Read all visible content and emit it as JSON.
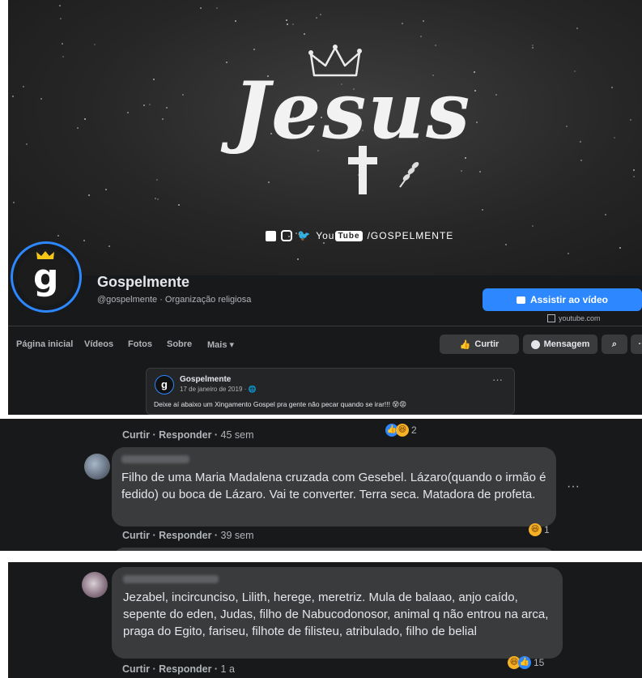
{
  "cover": {
    "script_word": "Jesus",
    "social_handle": "/GOSPELMENTE",
    "social_icons": [
      "facebook-icon",
      "instagram-icon",
      "twitter-icon",
      "youtube-icon"
    ],
    "youtube_word": "You",
    "youtube_box": "Tube"
  },
  "profile": {
    "avatar_letter": "g",
    "name": "Gospelmente",
    "subtitle": "@gospelmente · Organização religiosa",
    "cta_label": "Assistir ao vídeo",
    "cta_link": "youtube.com"
  },
  "nav": {
    "items": [
      "Página inicial",
      "Vídeos",
      "Fotos",
      "Sobre",
      "Mais ▾"
    ],
    "like_label": "Curtir",
    "message_label": "Mensagem",
    "search_glyph": "⌕",
    "more_glyph": "···"
  },
  "post": {
    "author": "Gospelmente",
    "date": "17 de janeiro de 2019 · ",
    "globe": "🌐",
    "text": "Deixe aí abaixo um Xingamento Gospel pra gente não pecar quando se irar!!! 😵😡",
    "dots": "···"
  },
  "comments": {
    "top_actions": {
      "like": "Curtir",
      "reply": "Responder",
      "time": "45 sem",
      "count": "2"
    },
    "first": {
      "text": "Filho de uma Maria Madalena cruzada com Gesebel. Lázaro(quando o irmão é fedido) ou boca de Lázaro. Vai te converter. Terra seca. Matadora de profeta.",
      "like": "Curtir",
      "reply": "Responder",
      "time": "39 sem",
      "count": "1",
      "dots": "···"
    },
    "second": {
      "text": "Jezabel, incircunciso, Lilith, herege, meretriz. Mula de balaao, anjo caído, sepente do eden, Judas, filho de Nabucodonosor, animal q não entrou na arca, praga do Egito, fariseu, filhote de filisteu, atribulado, filho de belial",
      "like": "Curtir",
      "reply": "Responder",
      "time": "1 a",
      "count": "15"
    },
    "separator": " · "
  },
  "colors": {
    "background": "#18191a",
    "bubble": "#3a3b3c",
    "accent": "#2d88ff",
    "text": "#e4e6eb",
    "muted": "#b0b3b8"
  }
}
